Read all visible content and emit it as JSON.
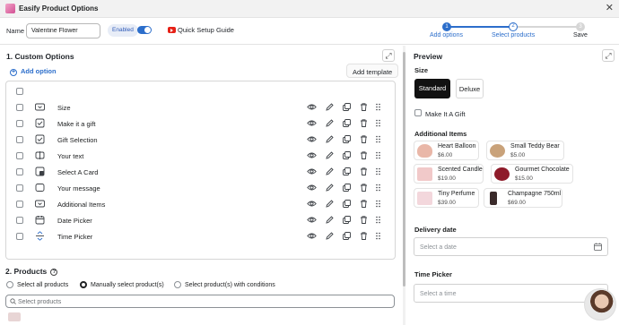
{
  "app": {
    "title": "Easify Product Options",
    "close_glyph": "✕"
  },
  "toolbar": {
    "name_label": "Name",
    "name_value": "Valentine Flower",
    "enabled_label": "Enabled",
    "enabled_on": true,
    "quick_setup": "Quick Setup Guide"
  },
  "steps": [
    {
      "number": "1",
      "label": "Add options",
      "state": "done"
    },
    {
      "number": "2",
      "label": "Select products",
      "state": "current"
    },
    {
      "number": "3",
      "label": "Save",
      "state": "todo"
    }
  ],
  "custom_options": {
    "title": "1. Custom Options",
    "add_option": "Add option",
    "add_template": "Add template",
    "rows": [
      {
        "label": "Size",
        "icon": "dropdown-icon"
      },
      {
        "label": "Make it a gift",
        "icon": "checkbox-icon"
      },
      {
        "label": "Gift Selection",
        "icon": "checkbox-icon"
      },
      {
        "label": "Your text",
        "icon": "text-field-icon"
      },
      {
        "label": "Select A Card",
        "icon": "image-swatch-icon"
      },
      {
        "label": "Your message",
        "icon": "textarea-icon"
      },
      {
        "label": "Additional Items",
        "icon": "dropdown-icon"
      },
      {
        "label": "Date Picker",
        "icon": "calendar-icon"
      },
      {
        "label": "Time Picker",
        "icon": "time-picker-icon"
      }
    ]
  },
  "products": {
    "title": "2. Products",
    "options": [
      "Select all products",
      "Manually select product(s)",
      "Select product(s) with conditions"
    ],
    "selected_index": 1,
    "search_placeholder": "Select products"
  },
  "preview": {
    "title": "Preview",
    "size_label": "Size",
    "sizes": [
      "Standard",
      "Deluxe"
    ],
    "selected_size": "Standard",
    "gift_label": "Make It A Gift",
    "additional_label": "Additional Items",
    "items": [
      {
        "name": "Heart Balloon",
        "price": "$6.00",
        "color": "#e9b7a8"
      },
      {
        "name": "Small Teddy Bear",
        "price": "$5.00",
        "color": "#c9a27a"
      },
      {
        "name": "Scented Candle",
        "price": "$19.00",
        "color": "#f1c9c9"
      },
      {
        "name": "Gourmet Chocolate",
        "price": "$15.00",
        "color": "#8e1b2a"
      },
      {
        "name": "Tiny Perfume",
        "price": "$39.00",
        "color": "#f3d7dc"
      },
      {
        "name": "Champagne 750ml",
        "price": "$69.00",
        "color": "#3a2a2a"
      }
    ],
    "delivery_label": "Delivery date",
    "date_placeholder": "Select a date",
    "time_label": "Time Picker",
    "time_placeholder": "Select a time"
  },
  "colors": {
    "accent": "#2c6ecb",
    "dark_button": "#111111",
    "brand_pink": "#d24f93"
  }
}
